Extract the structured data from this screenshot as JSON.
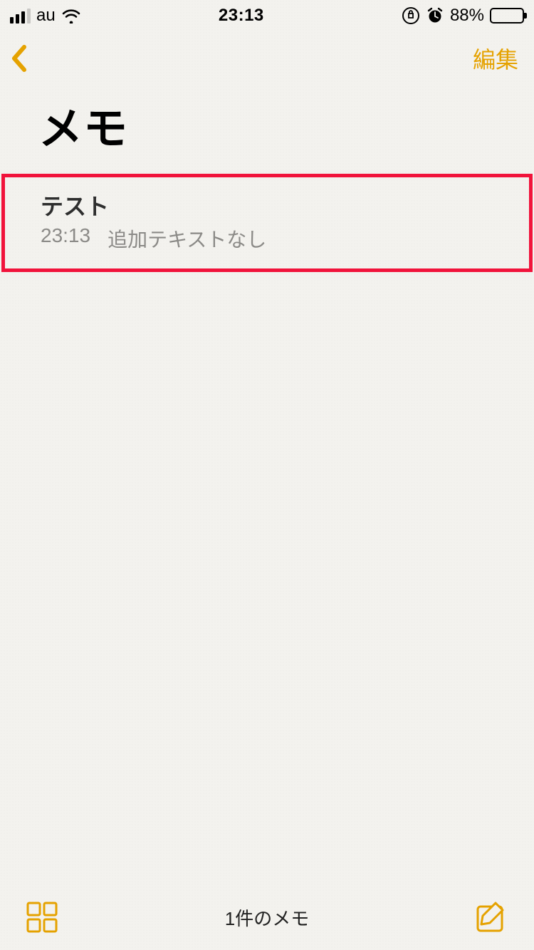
{
  "status_bar": {
    "carrier": "au",
    "time": "23:13",
    "battery_pct": "88%"
  },
  "nav": {
    "edit_label": "編集"
  },
  "page": {
    "title": "メモ"
  },
  "notes": [
    {
      "title": "テスト",
      "time": "23:13",
      "excerpt": "追加テキストなし"
    }
  ],
  "toolbar": {
    "count_label": "1件のメモ"
  },
  "colors": {
    "accent": "#e5a200",
    "highlight_border": "#f1133b"
  }
}
